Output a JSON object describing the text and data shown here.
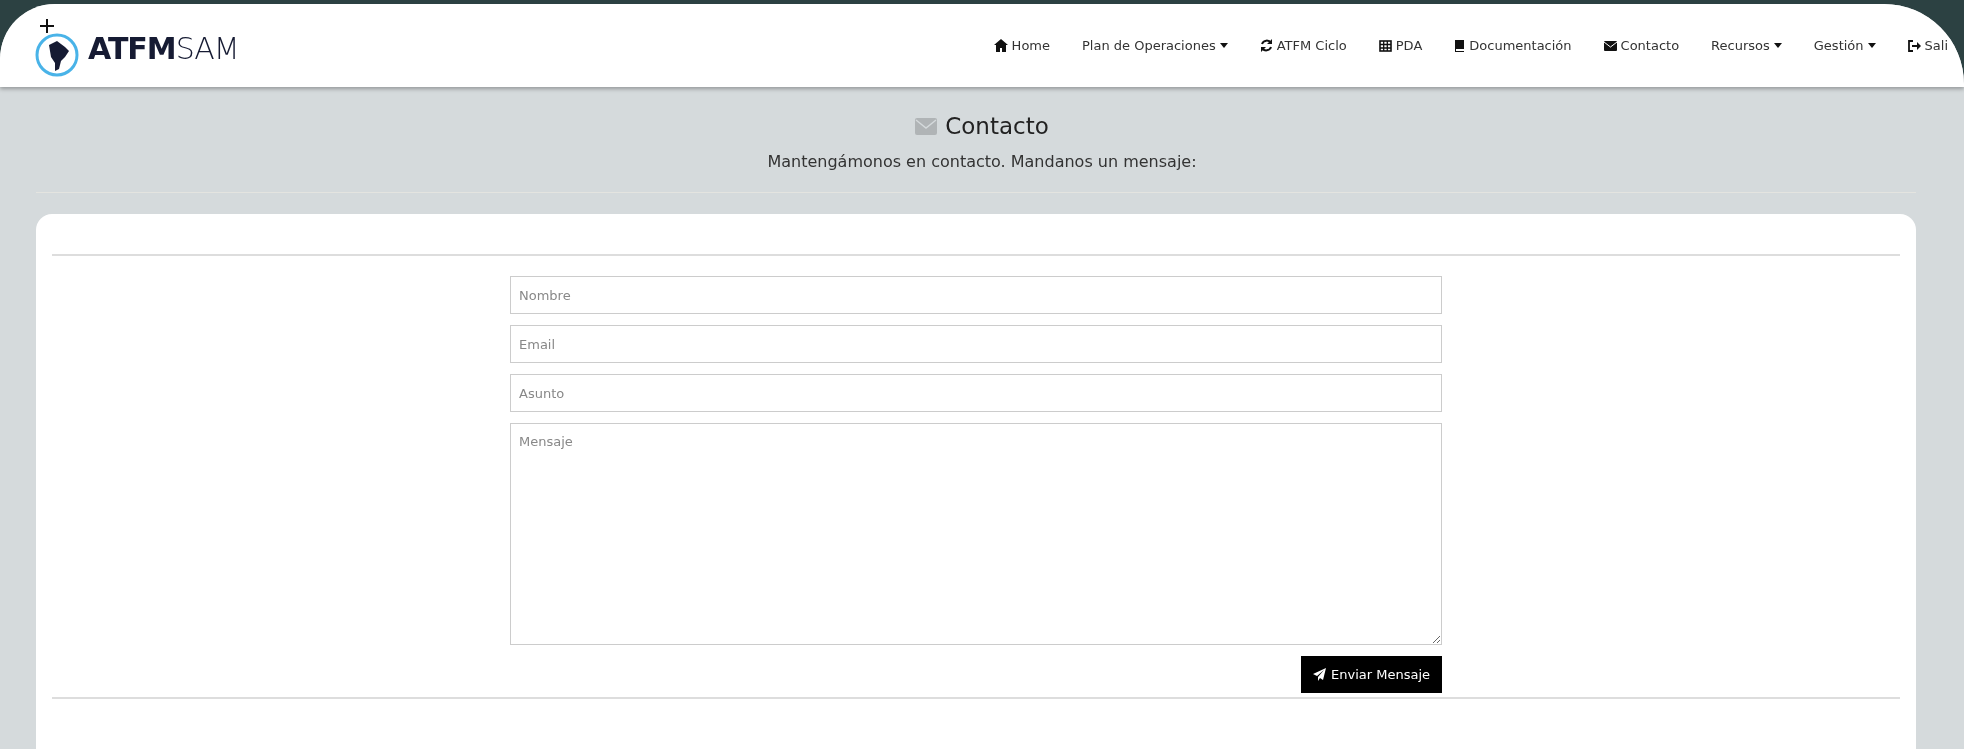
{
  "logo": {
    "text": "**ATFM**SAM"
  },
  "nav": [
    {
      "label": "Home",
      "dropdown": false
    },
    {
      "label": "Plan de Operaciones",
      "dropdown": true
    },
    {
      "label": "ATFM Ciclo",
      "dropdown": false
    },
    {
      "label": "PDA",
      "dropdown": false
    },
    {
      "label": "Documentación",
      "dropdown": false
    },
    {
      "label": "Contacto",
      "dropdown": false
    },
    {
      "label": "Recursos",
      "dropdown": true
    },
    {
      "label": "Gestión",
      "dropdown": true
    },
    {
      "label": "Sali",
      "dropdown": false
    }
  ],
  "header": {
    "title": "Contacto",
    "subtitle": "Mantengámonos en contacto. Mandanos un mensaje:"
  },
  "form": {
    "fields": [
      {
        "kind": "input",
        "placeholder": "Nombre"
      },
      {
        "kind": "input",
        "placeholder": "Email"
      },
      {
        "kind": "input",
        "placeholder": "Asunto"
      },
      {
        "kind": "textarea",
        "placeholder": "Mensaje"
      }
    ],
    "submit": "Enviar Mensaje"
  }
}
